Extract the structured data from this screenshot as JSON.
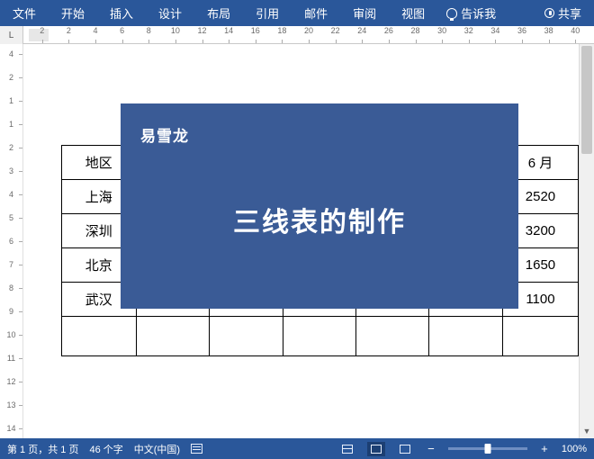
{
  "ribbon": {
    "tabs": [
      "文件",
      "开始",
      "插入",
      "设计",
      "布局",
      "引用",
      "邮件",
      "审阅",
      "视图"
    ],
    "tell_me": "告诉我",
    "share": "共享"
  },
  "ruler_corner": "L",
  "h_ruler_numbers": [
    "2",
    "2",
    "4",
    "6",
    "8",
    "10",
    "12",
    "14",
    "16",
    "18",
    "20",
    "22",
    "24",
    "26",
    "28",
    "30",
    "32",
    "34",
    "36",
    "38",
    "40"
  ],
  "v_ruler_numbers": [
    "4",
    "2",
    "1",
    "1",
    "2",
    "3",
    "4",
    "5",
    "6",
    "7",
    "8",
    "9",
    "10",
    "11",
    "12",
    "13",
    "14"
  ],
  "table": {
    "rows": [
      [
        "地区",
        "",
        "",
        "",
        "",
        "",
        "6 月"
      ],
      [
        "上海",
        "",
        "",
        "",
        "",
        "",
        "2520"
      ],
      [
        "深圳",
        "",
        "",
        "",
        "",
        "",
        "3200"
      ],
      [
        "北京",
        "",
        "",
        "",
        "",
        "",
        "1650"
      ],
      [
        "武汉",
        "",
        "",
        "",
        "",
        "",
        "1100"
      ],
      [
        "",
        "",
        "",
        "",
        "",
        "",
        ""
      ]
    ]
  },
  "overlay": {
    "logo": "易雪龙",
    "title": "三线表的制作"
  },
  "statusbar": {
    "page": "第 1 页，共 1 页",
    "words": "46 个字",
    "lang": "中文(中国)",
    "zoom_pct": "100%"
  },
  "chart_data": {
    "type": "table",
    "title": "三线表的制作",
    "columns": [
      "地区",
      "",
      "",
      "",
      "",
      "",
      "6 月"
    ],
    "rows": [
      [
        "上海",
        "",
        "",
        "",
        "",
        "",
        2520
      ],
      [
        "深圳",
        "",
        "",
        "",
        "",
        "",
        3200
      ],
      [
        "北京",
        "",
        "",
        "",
        "",
        "",
        1650
      ],
      [
        "武汉",
        "",
        "",
        "",
        "",
        "",
        1100
      ]
    ]
  }
}
